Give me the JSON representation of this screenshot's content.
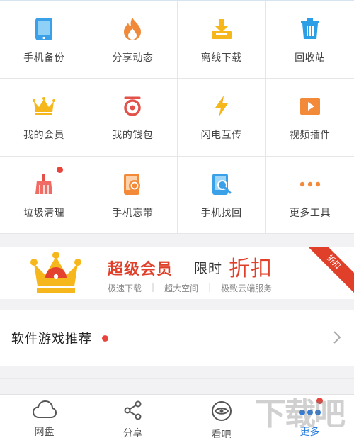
{
  "tools": [
    {
      "label": "手机备份",
      "icon": "phone-icon",
      "badge": false
    },
    {
      "label": "分享动态",
      "icon": "flame-icon",
      "badge": true
    },
    {
      "label": "离线下载",
      "icon": "download-tray-icon",
      "badge": false
    },
    {
      "label": "回收站",
      "icon": "trash-icon",
      "badge": false
    },
    {
      "label": "我的会员",
      "icon": "crown-icon",
      "badge": false
    },
    {
      "label": "我的钱包",
      "icon": "wallet-icon",
      "badge": false
    },
    {
      "label": "闪电互传",
      "icon": "lightning-icon",
      "badge": false
    },
    {
      "label": "视频插件",
      "icon": "play-icon",
      "badge": false
    },
    {
      "label": "垃圾清理",
      "icon": "broom-icon",
      "badge": true
    },
    {
      "label": "手机忘带",
      "icon": "phone-cloud-icon",
      "badge": false
    },
    {
      "label": "手机找回",
      "icon": "phone-search-icon",
      "badge": false
    },
    {
      "label": "更多工具",
      "icon": "more-dots-icon",
      "badge": false
    }
  ],
  "vip": {
    "title": "超级会员",
    "limited": "限时",
    "discount": "折扣",
    "ribbon": "折扣",
    "features": [
      "极速下载",
      "超大空间",
      "极致云端服务"
    ]
  },
  "recommend": {
    "label": "软件游戏推荐"
  },
  "tabs": [
    {
      "label": "网盘",
      "icon": "cloud-icon",
      "active": false
    },
    {
      "label": "分享",
      "icon": "share-icon",
      "active": false
    },
    {
      "label": "看吧",
      "icon": "eye-icon",
      "active": false
    },
    {
      "label": "更多",
      "icon": "more-dots-icon",
      "active": true
    }
  ],
  "watermark": "下载吧",
  "colors": {
    "accent": "#2b7de0",
    "red": "#e8443b",
    "gold": "#f6b71c",
    "orange": "#f28a3a"
  }
}
